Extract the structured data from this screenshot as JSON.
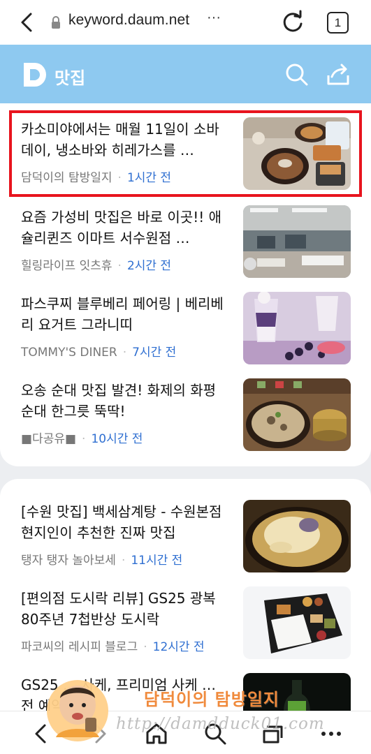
{
  "browser": {
    "url": "keyword.daum.net",
    "more": "···",
    "tab_count": "1"
  },
  "header": {
    "logo": "D",
    "title": "맛집"
  },
  "colors": {
    "header_bg": "#8ec9f0",
    "time_text": "#2f6fd1",
    "highlight_border": "#e8141e"
  },
  "group1": [
    {
      "title": "카소미야에서는 매월 11일이 소바데이, 냉소바와 히레가스를 …",
      "source": "담덕이의 탐방일지",
      "time": "1시간 전",
      "thumb": "soba-meal-photo"
    },
    {
      "title": "요즘 가성비 맛집은 바로 이곳!! 애슐리퀸즈 이마트 서수원점 …",
      "source": "힐링라이프 잇츠휴",
      "time": "2시간 전",
      "thumb": "buffet-restaurant-photo"
    },
    {
      "title": "파스쿠찌 블루베리 페어링 | 베리베리 요거트 그라니띠",
      "source": "TOMMY'S DINER",
      "time": "7시간 전",
      "thumb": "blueberry-drink-photo"
    },
    {
      "title": "오송 순대 맛집 발견! 화제의 화평 순대 한그릇 뚝딱!",
      "source": "■다공유■",
      "time": "10시간 전",
      "thumb": "sundae-soup-photo"
    }
  ],
  "group2": [
    {
      "title": "[수원 맛집] 백세삼계탕 - 수원본점 현지인이 추천한 진짜 맛집",
      "source": "탱자 탱자 놀아보세",
      "time": "11시간 전",
      "thumb": "samgyetang-photo"
    },
    {
      "title": "[편의점 도시락 리뷰] GS25 광복 80주년 7첩반상 도시락",
      "source": "파코씨의 레시피 블로그",
      "time": "12시간 전",
      "thumb": "lunchbox-photo"
    },
    {
      "title": "GS25 … 사케, 프리미엄 사케 … 전 예약 …",
      "source": "",
      "time": "",
      "thumb": "sake-bottle-photo"
    }
  ],
  "watermark": {
    "brand": "담덕이의 탐방일지",
    "url": "http://damdduck01.com"
  },
  "nav": [
    "back-icon",
    "forward-icon",
    "home-icon",
    "search-icon",
    "tabs-icon",
    "more-icon"
  ]
}
